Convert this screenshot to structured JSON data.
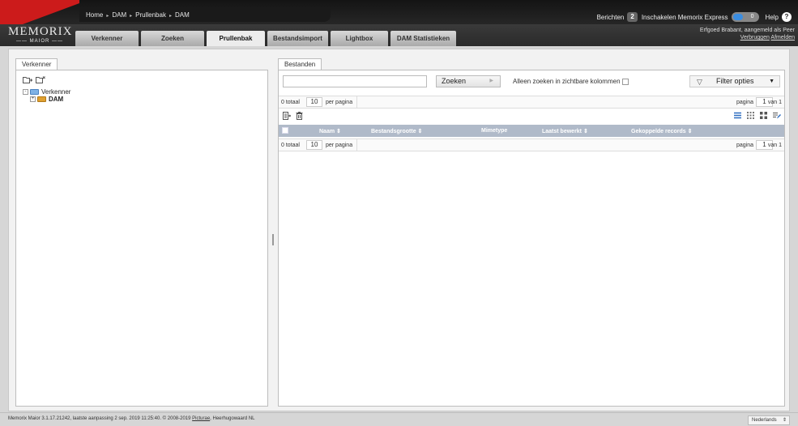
{
  "colors": {
    "logo_red": "#cc1b1b",
    "active_toggle": "#3a8de0",
    "table_header": "#b0bac9",
    "folder_open": "#7fb2e5",
    "folder_dam": "#e0a030"
  },
  "breadcrumb": {
    "items": [
      "Home",
      "DAM",
      "Prullenbak",
      "DAM"
    ],
    "separator": "▸"
  },
  "top_right": {
    "messages_label": "Berichten",
    "messages_count": "2",
    "express_label": "Inschakelen Memorix Express",
    "express_value": "0",
    "help_label": "Help",
    "help_icon": "?"
  },
  "logo": {
    "line1": "MEMORIX",
    "line2": "MAIOR"
  },
  "tabs": [
    {
      "label": "Verkenner",
      "active": false
    },
    {
      "label": "Zoeken",
      "active": false
    },
    {
      "label": "Prullenbak",
      "active": true
    },
    {
      "label": "Bestandsimport",
      "active": false
    },
    {
      "label": "Lightbox",
      "active": false
    },
    {
      "label": "DAM Statistieken",
      "active": false
    }
  ],
  "user": {
    "line1": "Erfgoed Brabant, aangemeld als Peer",
    "change_link": "Verbruggen",
    "logout_link": "Afmelden"
  },
  "left_panel": {
    "tab": "Verkenner",
    "icons": [
      "folder-add-icon",
      "folder-remove-icon"
    ],
    "tree": [
      {
        "label": "Verkenner",
        "expander": "-",
        "icon": "open-folder-icon",
        "level": 0,
        "bold": false
      },
      {
        "label": "DAM",
        "expander": "+",
        "icon": "folder-icon",
        "level": 1,
        "bold": true
      }
    ]
  },
  "right_panel": {
    "tab": "Bestanden",
    "search": {
      "placeholder": "",
      "value": "",
      "button": "Zoeken",
      "visible_cols_label": "Alleen zoeken in zichtbare kolommen"
    },
    "filter_label": "Filter opties",
    "pager_top": {
      "total": "0 totaal",
      "per_page_value": "10",
      "per_page_label": "per pagina",
      "page_label": "pagina",
      "page_value": "1",
      "of_label": "van 1"
    },
    "pager_bottom": {
      "total": "0 totaal",
      "per_page_value": "10",
      "per_page_label": "per pagina",
      "page_label": "pagina",
      "page_value": "1",
      "of_label": "van 1"
    },
    "toolbar_left_icons": [
      "restore-icon",
      "trash-icon"
    ],
    "view_icons": [
      "list-view-icon",
      "grid-view-icon",
      "thumbnail-view-icon",
      "edit-view-icon"
    ],
    "columns": [
      {
        "label": "Naam ⇕"
      },
      {
        "label": "Bestandsgrootte ⇕"
      },
      {
        "label": "Mimetype"
      },
      {
        "label": "Laatst bewerkt ⇕"
      },
      {
        "label": "Gekoppelde records ⇕"
      }
    ]
  },
  "footer": {
    "text": "Memorix Maior 3.1.17.21242, laatste aanpassing 2 sep. 2019 11:25:40. © 2008-2019",
    "link": "Picturae",
    "suffix": ", Heerhugowaard NL",
    "language": "Nederlands"
  }
}
